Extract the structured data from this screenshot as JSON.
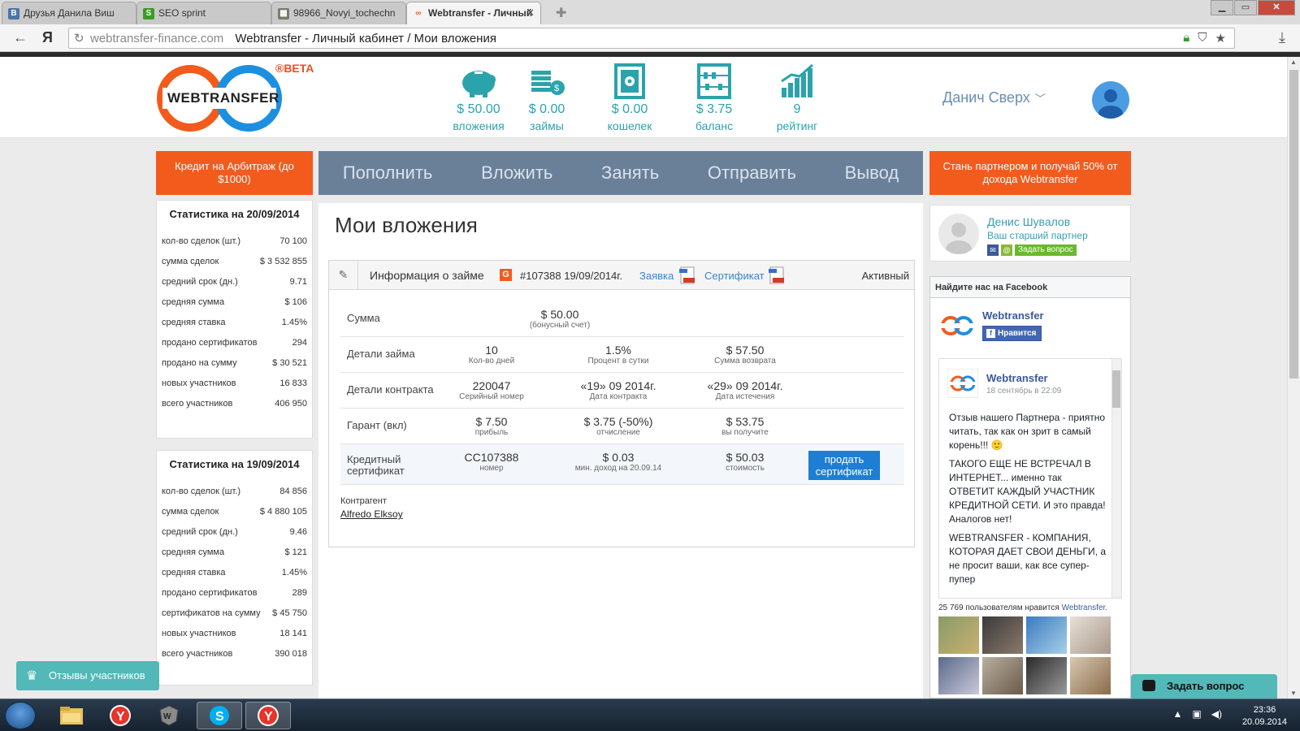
{
  "browser": {
    "tabs": [
      {
        "label": "Друзья Данила Виш",
        "icon": "vk-icon",
        "color": "#4a76a8"
      },
      {
        "label": "SEO sprint",
        "icon": "seosprint-icon",
        "color": "#3a9d23"
      },
      {
        "label": "98966_Novyi_tochechn",
        "icon": "image-icon",
        "color": "#6d6d6d"
      },
      {
        "label": "Webtransfer - Личный",
        "icon": "webtransfer-icon",
        "color": "#f35b1d"
      }
    ],
    "address_domain": "webtransfer-finance.com",
    "address_title": "Webtransfer - Личный кабинет / Мои вложения"
  },
  "header": {
    "brand": "WEBTRANSFER",
    "beta": "®BETA",
    "stats": [
      {
        "value": "$ 50.00",
        "label": "вложения",
        "icon": "piggy-bank-icon"
      },
      {
        "value": "$ 0.00",
        "label": "займы",
        "icon": "coins-stack-icon"
      },
      {
        "value": "$ 0.00",
        "label": "кошелек",
        "icon": "safe-icon"
      },
      {
        "value": "$ 3.75",
        "label": "баланс",
        "icon": "abacus-icon"
      },
      {
        "value": "9",
        "label": "рейтинг",
        "icon": "rating-chart-icon"
      }
    ],
    "user_name": "Данич Сверх"
  },
  "actions": {
    "left_button": "Кредит на Арбитраж (до $1000)",
    "menu": [
      "Пополнить",
      "Вложить",
      "Занять",
      "Отправить",
      "Вывод"
    ],
    "right_button": "Стань партнером и получай 50% от дохода Webtransfer"
  },
  "stats_today": {
    "title": "Статистика на 20/09/2014",
    "rows": [
      {
        "label": "кол-во сделок (шт.)",
        "value": "70 100"
      },
      {
        "label": "сумма сделок",
        "value": "$ 3 532 855"
      },
      {
        "label": "средний срок (дн.)",
        "value": "9.71"
      },
      {
        "label": "средняя сумма",
        "value": "$ 106"
      },
      {
        "label": "средняя ставка",
        "value": "1.45%"
      },
      {
        "label": "продано сертификатов",
        "value": "294"
      },
      {
        "label": "продано на сумму",
        "value": "$ 30 521"
      },
      {
        "label": "новых участников",
        "value": "16 833"
      },
      {
        "label": "всего участников",
        "value": "406 950"
      }
    ]
  },
  "stats_prev": {
    "title": "Статистика на 19/09/2014",
    "rows": [
      {
        "label": "кол-во сделок (шт.)",
        "value": "84 856"
      },
      {
        "label": "сумма сделок",
        "value": "$ 4 880 105"
      },
      {
        "label": "средний срок (дн.)",
        "value": "9.46"
      },
      {
        "label": "средняя сумма",
        "value": "$ 121"
      },
      {
        "label": "средняя ставка",
        "value": "1.45%"
      },
      {
        "label": "продано сертификатов",
        "value": "289"
      },
      {
        "label": "сертификатов на сумму",
        "value": "$ 45 750"
      },
      {
        "label": "новых участников",
        "value": "18 141"
      },
      {
        "label": "всего участников",
        "value": "390 018"
      }
    ]
  },
  "main": {
    "title": "Мои вложения",
    "loan": {
      "header_title": "Информация о займе",
      "badge": "G",
      "number": "#107388 19/09/2014г.",
      "link_request": "Заявка",
      "link_certificate": "Сертификат",
      "status": "Активный",
      "sum": {
        "label": "Сумма",
        "value": "$ 50.00",
        "sub": "(бонусный счет)"
      },
      "details": {
        "label": "Детали займа",
        "cells": [
          {
            "v": "10",
            "s": "Кол-во дней"
          },
          {
            "v": "1.5%",
            "s": "Процент в сутки"
          },
          {
            "v": "$ 57.50",
            "s": "Сумма возврата"
          }
        ]
      },
      "contract": {
        "label": "Детали контракта",
        "cells": [
          {
            "v": "220047",
            "s": "Серийный номер"
          },
          {
            "v": "«19» 09 2014г.",
            "s": "Дата контракта"
          },
          {
            "v": "«29» 09 2014г.",
            "s": "Дата истечения"
          }
        ]
      },
      "guarant": {
        "label": "Гарант (вкл)",
        "cells": [
          {
            "v": "$ 7.50",
            "s": "прибыль"
          },
          {
            "v": "$ 3.75 (-50%)",
            "s": "отчисление"
          },
          {
            "v": "$ 53.75",
            "s": "вы получите"
          }
        ]
      },
      "certificate": {
        "label": "Кредитный сертификат",
        "cells": [
          {
            "v": "CC107388",
            "s": "номер"
          },
          {
            "v": "$ 0.03",
            "s": "мин. доход на 20.09.14"
          },
          {
            "v": "$ 50.03",
            "s": "стоимость"
          }
        ],
        "sell_button": "продать сертификат"
      },
      "counterparty_label": "Контрагент",
      "counterparty_name": "Alfredo Elksoy"
    }
  },
  "partner": {
    "name": "Денис Шувалов",
    "role": "Ваш старший партнер",
    "ask_button": "Задать вопрос"
  },
  "facebook": {
    "header": "Найдите нас на Facebook",
    "page_name": "Webtransfer",
    "like_button": "Нравится",
    "post_author": "Webtransfer",
    "post_date": "18 сентябрь в 22:09",
    "post_p1": "Отзыв нашего Партнера - приятно читать, так как он зрит в самый корень!!! 🙂",
    "post_p2": "ТАКОГО ЕЩЕ НЕ ВСТРЕЧАЛ В ИНТЕРНЕТ... именно так ОТВЕТИТ КАЖДЫЙ УЧАСТНИК КРЕДИТНОЙ СЕТИ. И это правда! Аналогов нет!",
    "post_p3": "WEBTRANSFER - КОМПАНИЯ, КОТОРАЯ ДАЕТ СВОИ ДЕНЬГИ, а не просит ваши, как все супер-пупер",
    "likes_count": "25 769 пользователям нравится",
    "likes_page": "Webtransfer."
  },
  "widgets": {
    "reviews": "Отзывы участников",
    "ask": "Задать вопрос"
  },
  "taskbar": {
    "time": "23:36",
    "date": "20.09.2014"
  }
}
